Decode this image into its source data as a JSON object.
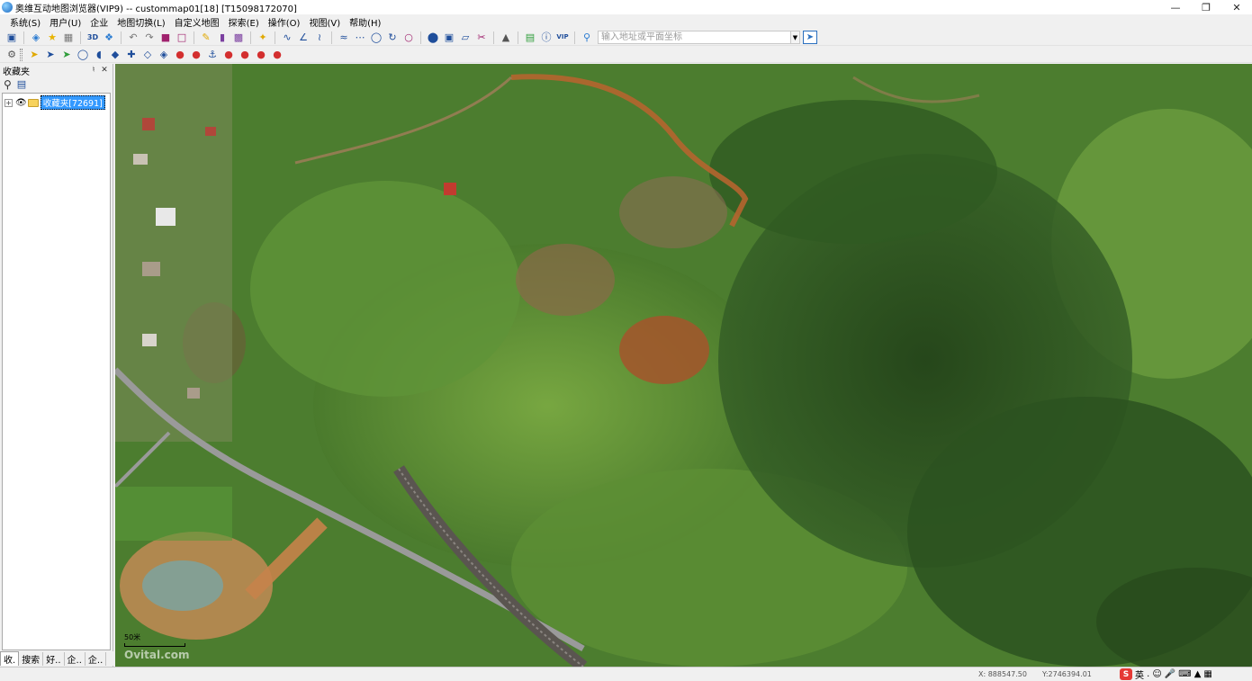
{
  "window": {
    "title": "奥维互动地图浏览器(VIP9) -- custommap01[18] [T15098172070]",
    "app_icon": "globe-icon"
  },
  "menu": [
    "系统(S)",
    "用户(U)",
    "企业",
    "地图切换(L)",
    "自定义地图",
    "探索(E)",
    "操作(O)",
    "视图(V)",
    "帮助(H)"
  ],
  "toolbar": {
    "search_placeholder": "输入地址或平面坐标",
    "three_d_label": "3D",
    "vip_label": "VIP"
  },
  "sidebar": {
    "title": "收藏夹",
    "pin_icon": "pin-icon",
    "close_icon": "close-icon",
    "tree_root_label": "收藏夹[72691]",
    "tabs": [
      "收.",
      "搜索",
      "好..",
      "企..",
      "企.."
    ]
  },
  "map": {
    "scale_label": "50米",
    "watermark": "Ovital.com"
  },
  "status": {
    "x_coord": "X: 888547.50",
    "y_coord": "Y:2746394.01",
    "ime_text": "英"
  },
  "colors": {
    "selection": "#3399ff",
    "forest_dark": "#2f5a22",
    "forest_light": "#6ea03c",
    "soil": "#b5652f",
    "road": "#9a9a9a"
  }
}
